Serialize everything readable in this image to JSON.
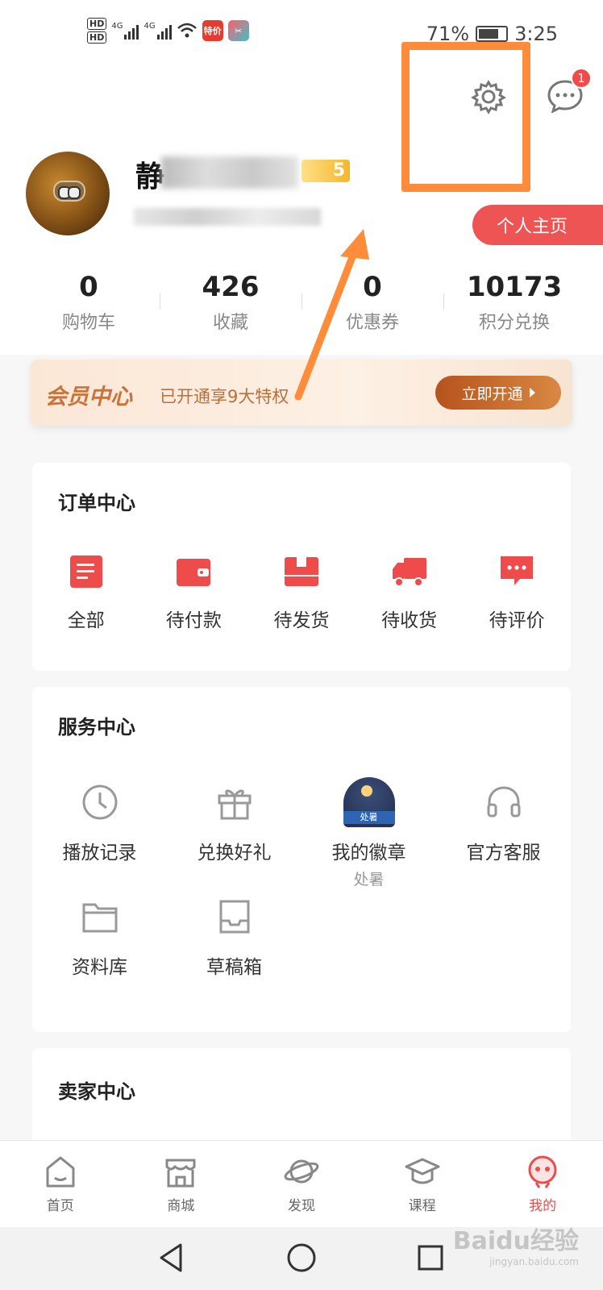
{
  "status_bar": {
    "hd1": "HD",
    "hd2": "HD",
    "net1": "4G",
    "net2": "4G",
    "app1": "特价",
    "battery_pct": "71%",
    "time": "3:25"
  },
  "header": {
    "message_badge_count": "1",
    "username_visible_char": "静",
    "level_badge": "5",
    "profile_button_label": "个人主页"
  },
  "stats": [
    {
      "value": "0",
      "label": "购物车"
    },
    {
      "value": "426",
      "label": "收藏"
    },
    {
      "value": "0",
      "label": "优惠券"
    },
    {
      "value": "10173",
      "label": "积分兑换"
    }
  ],
  "vip": {
    "title": "会员中心",
    "subtitle": "已开通享9大特权",
    "button_label": "立即开通"
  },
  "orders": {
    "title": "订单中心",
    "items": [
      {
        "label": "全部",
        "icon": "list-icon"
      },
      {
        "label": "待付款",
        "icon": "wallet-icon"
      },
      {
        "label": "待发货",
        "icon": "box-icon"
      },
      {
        "label": "待收货",
        "icon": "truck-icon"
      },
      {
        "label": "待评价",
        "icon": "comment-icon"
      }
    ]
  },
  "services": {
    "title": "服务中心",
    "items": [
      {
        "label": "播放记录",
        "icon": "clock-icon"
      },
      {
        "label": "兑换好礼",
        "icon": "gift-icon"
      },
      {
        "label": "我的徽章",
        "sub": "处暑",
        "icon": "badge-icon",
        "medal_text": "处暑"
      },
      {
        "label": "官方客服",
        "icon": "headset-icon"
      },
      {
        "label": "资料库",
        "icon": "folder-icon"
      },
      {
        "label": "草稿箱",
        "icon": "inbox-icon"
      }
    ]
  },
  "seller": {
    "title": "卖家中心"
  },
  "tabbar": [
    {
      "label": "首页",
      "icon": "home-icon"
    },
    {
      "label": "商城",
      "icon": "shop-icon"
    },
    {
      "label": "发现",
      "icon": "planet-icon"
    },
    {
      "label": "课程",
      "icon": "graduation-cap-icon"
    },
    {
      "label": "我的",
      "icon": "mascot-icon",
      "active": true
    }
  ],
  "watermark": {
    "brand": "Baidu经验",
    "url": "jingyan.baidu.com"
  },
  "colors": {
    "accent_red": "#ee4b4b",
    "highlight_orange": "#ff8c3a",
    "vip_brown": "#c9733a"
  }
}
